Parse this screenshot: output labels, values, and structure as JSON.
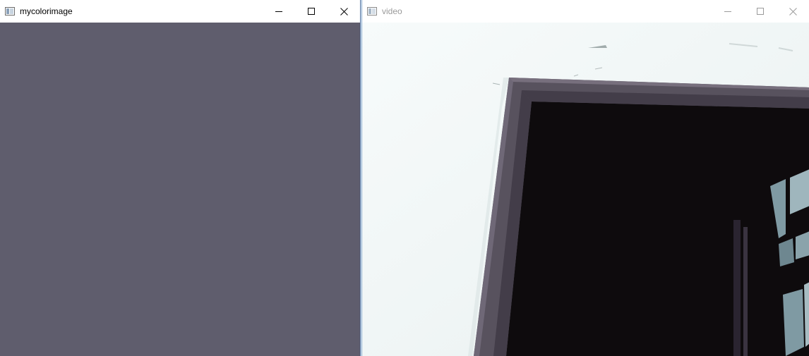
{
  "windows": {
    "left": {
      "title": "mycolorimage",
      "fill_color": "#5f5d6d",
      "controls": {
        "minimize_icon": "minimize-icon",
        "maximize_icon": "maximize-icon",
        "close_icon": "close-icon"
      }
    },
    "right": {
      "title": "video",
      "controls": {
        "minimize_icon": "minimize-icon",
        "maximize_icon": "maximize-icon",
        "close_icon": "close-icon"
      }
    }
  },
  "colors": {
    "active_border": "#4a6fa0",
    "inactive_title_text": "#9a9a9a",
    "swatch": "#5f5d6d"
  }
}
